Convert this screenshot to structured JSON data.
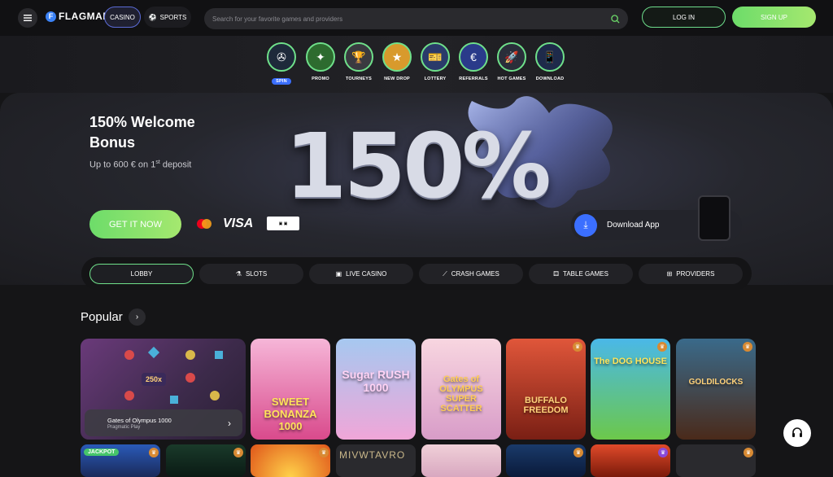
{
  "header": {
    "menu_icon": "hamburger-icon",
    "logo_mark": "F",
    "logo_text": "FLAGMAN",
    "casino_label": "CASINO",
    "sports_label": "SPORTS",
    "search_placeholder": "Search for your favorite games and providers",
    "login_label": "LOG IN",
    "signup_label": "SIGN UP"
  },
  "quick_links": [
    {
      "label": "SPIN",
      "icon": "wheel-icon"
    },
    {
      "label": "PROMO",
      "icon": "promo-icon"
    },
    {
      "label": "TOURNEYS",
      "icon": "trophy-icon"
    },
    {
      "label": "NEW DROP",
      "icon": "new-drop-icon"
    },
    {
      "label": "LOTTERY",
      "icon": "lottery-icon"
    },
    {
      "label": "REFERRALS",
      "icon": "referrals-icon"
    },
    {
      "label": "HOT GAMES",
      "icon": "rocket-icon"
    },
    {
      "label": "DOWNLOAD",
      "icon": "download-icon"
    }
  ],
  "hero": {
    "title": "150% Welcome Bonus",
    "subtitle_main": "Up to 600 € on 1",
    "subtitle_sup": "st",
    "subtitle_end": " deposit",
    "big_text": "150%",
    "cta_label": "GET IT NOW",
    "visa_label": "VISA",
    "download_app_label": "Download App"
  },
  "categories": [
    {
      "label": "LOBBY",
      "icon": ""
    },
    {
      "label": "SLOTS",
      "icon": "slots-icon"
    },
    {
      "label": "LIVE CASINO",
      "icon": "live-icon"
    },
    {
      "label": "CRASH GAMES",
      "icon": "chart-icon"
    },
    {
      "label": "TABLE GAMES",
      "icon": "cards-icon"
    },
    {
      "label": "PROVIDERS",
      "icon": "grid-icon"
    }
  ],
  "popular": {
    "title": "Popular",
    "featured_name": "Gates of Olympus 1000",
    "featured_provider": "Pragmatic Play",
    "games": [
      {
        "title": "SWEET BONANZA 1000",
        "bg": "#d94a8c"
      },
      {
        "title": "Sugar RUSH 1000",
        "bg": "#a6c8f0"
      },
      {
        "title": "Gates of OLYMPUS SUPER SCATTER",
        "bg": "#f2b6c8"
      },
      {
        "title": "BUFFALO FREEDOM",
        "bg": "#c03a22"
      },
      {
        "title": "The DOG HOUSE",
        "bg": "#3fa7d9"
      },
      {
        "title": "GOLDILOCKS",
        "bg": "#5a3a2a"
      }
    ],
    "jackpot_label": "JACKPOT",
    "row2_text": "MIVWTAVRO"
  },
  "colors": {
    "accent_green": "#6ddc6a",
    "accent_blue": "#3b6fff",
    "background": "#151517"
  }
}
